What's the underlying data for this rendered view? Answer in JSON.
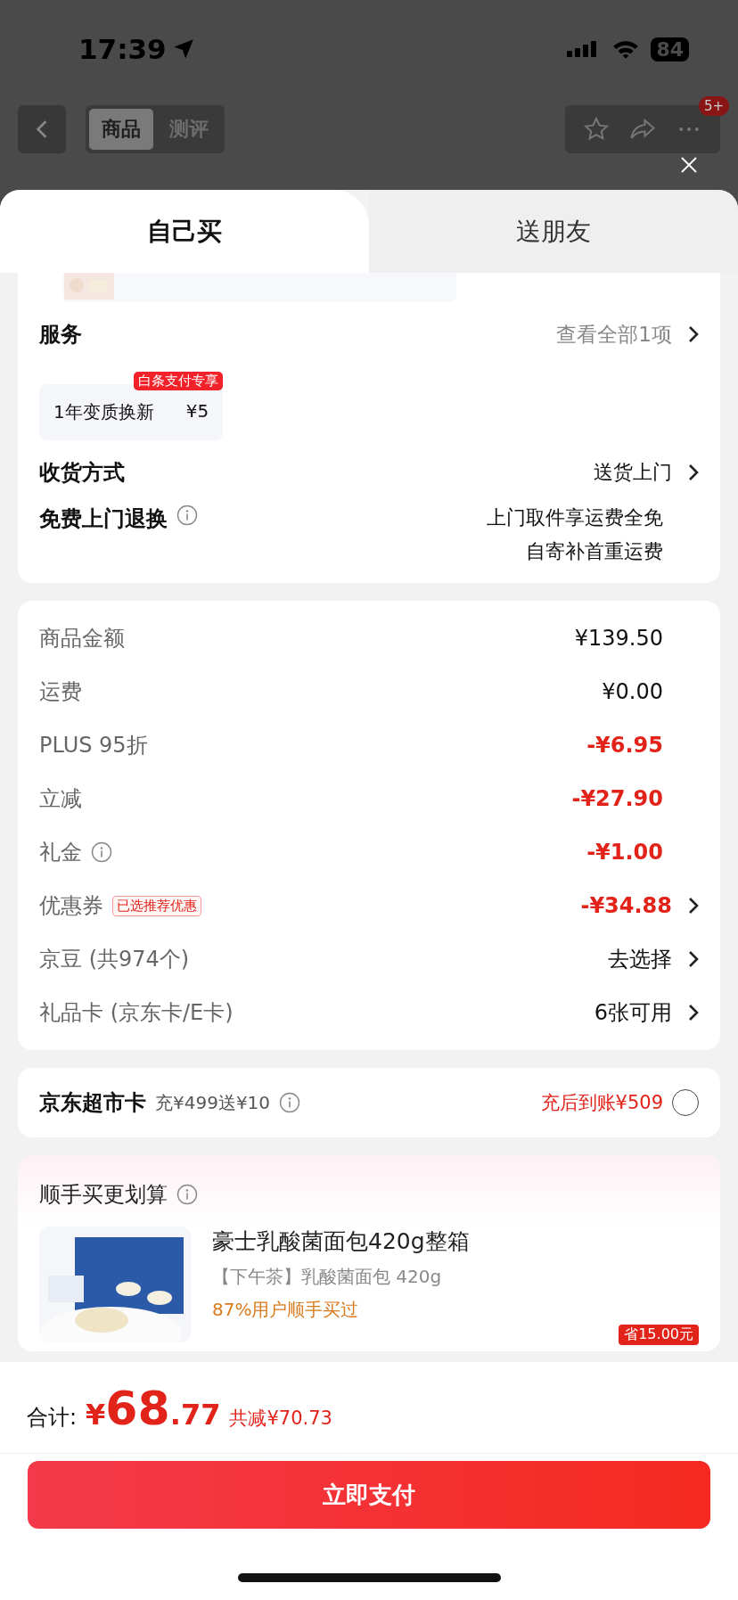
{
  "status_bar": {
    "time": "17:39",
    "battery": "84"
  },
  "background_header": {
    "tabs": [
      {
        "label": "商品",
        "selected": true
      },
      {
        "label": "测评",
        "selected": false
      }
    ],
    "badge": "5+"
  },
  "sheet_tabs": [
    {
      "label": "自己买",
      "selected": true
    },
    {
      "label": "送朋友",
      "selected": false
    }
  ],
  "services": {
    "title": "服务",
    "link": "查看全部1项",
    "options": [
      {
        "name": "1年变质换新",
        "price": "¥5",
        "tag": "白条支付专享"
      }
    ]
  },
  "delivery": {
    "label": "收货方式",
    "value": "送货上门"
  },
  "returns": {
    "label": "免费上门退换",
    "lines": [
      "上门取件享运费全免",
      "自寄补首重运费"
    ]
  },
  "price_rows": [
    {
      "label": "商品金额",
      "value": "¥139.50",
      "kind": "amount",
      "info": false,
      "arrow": false
    },
    {
      "label": "运费",
      "value": "¥0.00",
      "kind": "amount",
      "info": false,
      "arrow": false
    },
    {
      "label": "PLUS 95折",
      "value": "-¥6.95",
      "kind": "discount",
      "info": false,
      "arrow": false
    },
    {
      "label": "立减",
      "value": "-¥27.90",
      "kind": "discount",
      "info": false,
      "arrow": false
    },
    {
      "label": "礼金",
      "value": "-¥1.00",
      "kind": "discount",
      "info": true,
      "arrow": false
    },
    {
      "label": "优惠券",
      "tag": "已选推荐优惠",
      "value": "-¥34.88",
      "kind": "discount",
      "info": false,
      "arrow": true
    },
    {
      "label": "京豆 (共974个)",
      "value": "去选择",
      "kind": "choice",
      "info": false,
      "arrow": true
    },
    {
      "label": "礼品卡 (京东卡/E卡)",
      "value": "6张可用",
      "kind": "choice",
      "info": false,
      "arrow": true
    }
  ],
  "market_card": {
    "title": "京东超市卡",
    "offer": "充¥499送¥10",
    "note": "充后到账¥509",
    "checked": false
  },
  "suggestion": {
    "title": "顺手买更划算",
    "product": {
      "name": "豪士乳酸菌面包420g整箱",
      "subtitle": "【下午茶】乳酸菌面包 420g",
      "note": "87%用户顺手买过",
      "saving": "省15.00元"
    }
  },
  "footer": {
    "label": "合计:",
    "currency": "¥",
    "integer": "68",
    "decimal": ".77",
    "saving": "共减¥70.73",
    "button": "立即支付"
  }
}
